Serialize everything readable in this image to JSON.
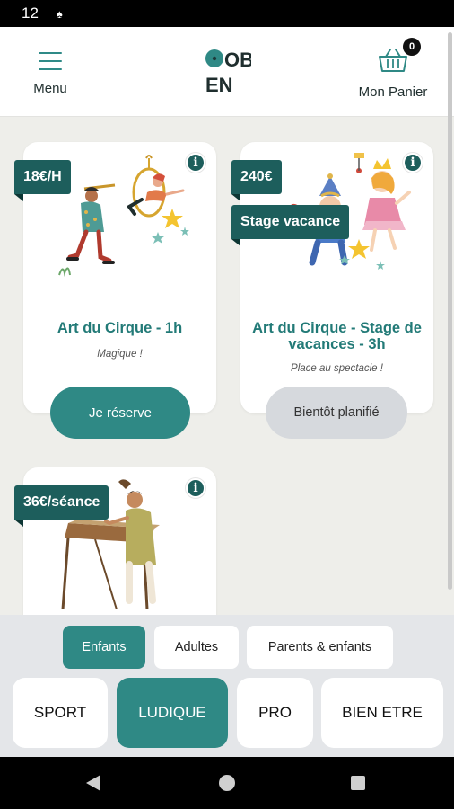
{
  "status_bar": {
    "time": "12",
    "icon": "notification-icon"
  },
  "header": {
    "menu_label": "Menu",
    "cart_label": "Mon Panier",
    "cart_count": "0",
    "logo_text": [
      "OB",
      "EN"
    ]
  },
  "cards": [
    {
      "price": "18€/H",
      "title": "Art du Cirque - 1h",
      "subtitle": "Magique !",
      "button": "Je réserve",
      "illustration": "circus-performers"
    },
    {
      "price": "240€",
      "tag": "Stage vacance",
      "title": "Art du Cirque - Stage de vacances - 3h",
      "subtitle": "Place au spectacle !",
      "button": "Bientôt planifié",
      "illustration": "circus-kids-party"
    },
    {
      "price": "36€/séance",
      "illustration": "person-at-drawing-table"
    }
  ],
  "audience_filters": [
    {
      "label": "Enfants",
      "active": true
    },
    {
      "label": "Adultes",
      "active": false
    },
    {
      "label": "Parents & enfants",
      "active": false
    }
  ],
  "categories": [
    {
      "label": "SPORT",
      "active": false
    },
    {
      "label": "LUDIQUE",
      "active": true
    },
    {
      "label": "PRO",
      "active": false
    },
    {
      "label": "BIEN ETRE",
      "active": false
    }
  ],
  "colors": {
    "primary": "#2f8985",
    "dark_teal": "#1d5e5c",
    "title_teal": "#227a77",
    "background": "#eeeeea"
  }
}
